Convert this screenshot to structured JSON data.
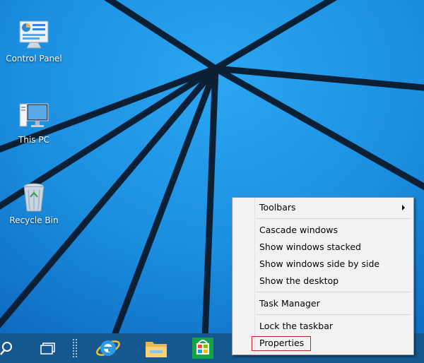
{
  "desktop": {
    "icons": [
      {
        "label": "Control Panel",
        "icon": "control-panel-icon"
      },
      {
        "label": "This PC",
        "icon": "computer-icon"
      },
      {
        "label": "Recycle Bin",
        "icon": "recycle-bin-icon"
      }
    ],
    "colors": {
      "background": "#1a8ee0",
      "wallpaper_lines": "#0a1e33"
    }
  },
  "taskbar": {
    "color": "#14588f",
    "items": [
      {
        "icon": "search-icon"
      },
      {
        "icon": "task-view-icon"
      },
      {
        "icon": "internet-explorer-icon"
      },
      {
        "icon": "file-explorer-icon"
      },
      {
        "icon": "store-icon"
      }
    ]
  },
  "context_menu": {
    "items": [
      {
        "label": "Toolbars",
        "submenu": true
      },
      {
        "label": "Cascade windows"
      },
      {
        "label": "Show windows stacked"
      },
      {
        "label": "Show windows side by side"
      },
      {
        "label": "Show the desktop"
      },
      {
        "label": "Task Manager"
      },
      {
        "label": "Lock the taskbar"
      },
      {
        "label": "Properties",
        "highlighted": true
      }
    ],
    "highlight_color": "#c0282d"
  }
}
